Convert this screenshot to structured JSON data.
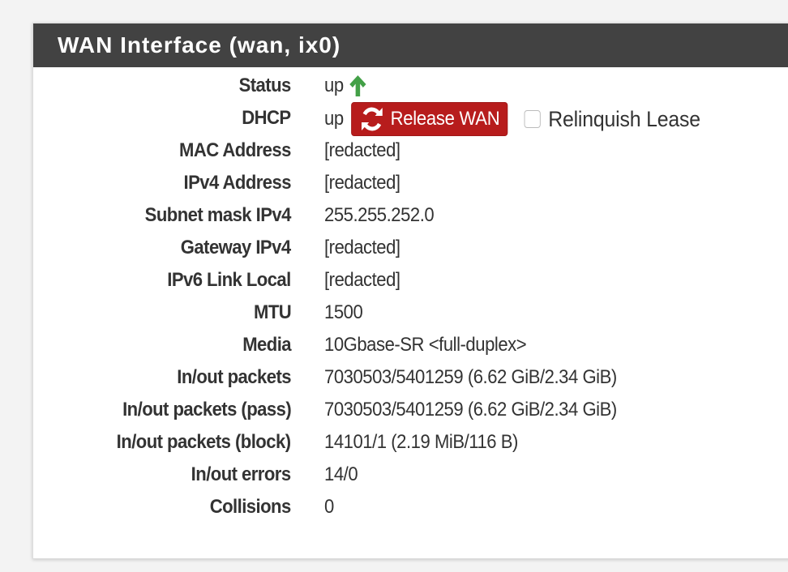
{
  "panel": {
    "title": "WAN Interface (wan, ix0)"
  },
  "colors": {
    "header_bg": "#424242",
    "status_up": "#43a047",
    "release_button": "#b71c1c"
  },
  "rows": [
    {
      "label": "Status",
      "value": "up",
      "icon": "arrow-up-icon"
    },
    {
      "label": "DHCP",
      "value": "up",
      "button": "Release WAN",
      "button_icon": "refresh-icon",
      "checkbox_label": "Relinquish Lease",
      "checkbox_checked": false
    },
    {
      "label": "MAC Address",
      "value": "[redacted]"
    },
    {
      "label": "IPv4 Address",
      "value": "[redacted]"
    },
    {
      "label": "Subnet mask IPv4",
      "value": "255.255.252.0"
    },
    {
      "label": "Gateway IPv4",
      "value": "[redacted]"
    },
    {
      "label": "IPv6 Link Local",
      "value": "[redacted]"
    },
    {
      "label": "MTU",
      "value": "1500"
    },
    {
      "label": "Media",
      "value": "10Gbase-SR <full-duplex>"
    },
    {
      "label": "In/out packets",
      "value": "7030503/5401259 (6.62 GiB/2.34 GiB)"
    },
    {
      "label": "In/out packets (pass)",
      "value": "7030503/5401259 (6.62 GiB/2.34 GiB)"
    },
    {
      "label": "In/out packets (block)",
      "value": "14101/1 (2.19 MiB/116 B)"
    },
    {
      "label": "In/out errors",
      "value": "14/0"
    },
    {
      "label": "Collisions",
      "value": "0"
    }
  ]
}
